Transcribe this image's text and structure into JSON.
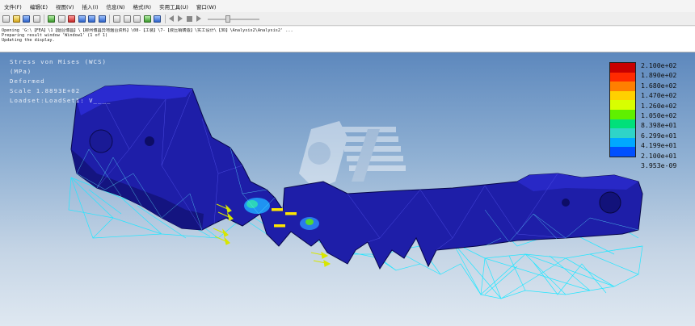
{
  "menu": [
    "文件(F)",
    "编辑(E)",
    "视图(V)",
    "插入(I)",
    "信息(N)",
    "格式(R)",
    "实用工具(U)",
    "窗口(W)"
  ],
  "toolbar": {
    "icons": [
      "new-icon",
      "open-icon",
      "save-icon",
      "print-icon",
      "copy-icon",
      "paste-icon",
      "delete-icon",
      "window-icon",
      "window-icon",
      "window-icon",
      "zoom-in-icon",
      "zoom-out-icon",
      "refit-icon",
      "spin-icon",
      "layers-icon",
      "rewind-icon",
      "play-icon",
      "stop-icon",
      "step-icon",
      "frame-slider"
    ]
  },
  "messages": [
    "Opening 'G:\\【FEA】\\1【烟台博昌】\\【柳州博昌异地烟台资料】\\08-【工装】\\7-【液压销铸造】\\实工设计\\【3D】\\Analysis2\\Analysis2' ...",
    "Preparing result window 'Window1' (1 of 1)",
    "Updating the display."
  ],
  "overlay": {
    "line1": "Stress von Mises (WCS)",
    "line2": "(MPa)",
    "line3": "Deformed",
    "line4": "Scale  1.8893E+02",
    "line5": "Loadset:LoadSet1: V____"
  },
  "legend": {
    "values": [
      "2.100e+02",
      "1.890e+02",
      "1.680e+02",
      "1.470e+02",
      "1.260e+02",
      "1.050e+02",
      "8.398e+01",
      "6.299e+01",
      "4.199e+01",
      "2.100e+01",
      "3.953e-09"
    ],
    "colors": [
      "#c80000",
      "#ff2a00",
      "#ff7f00",
      "#ffd000",
      "#d8ff00",
      "#5ff000",
      "#00e07a",
      "#2fd4c8",
      "#00a8ff",
      "#0050ff",
      "#0000c8"
    ]
  }
}
